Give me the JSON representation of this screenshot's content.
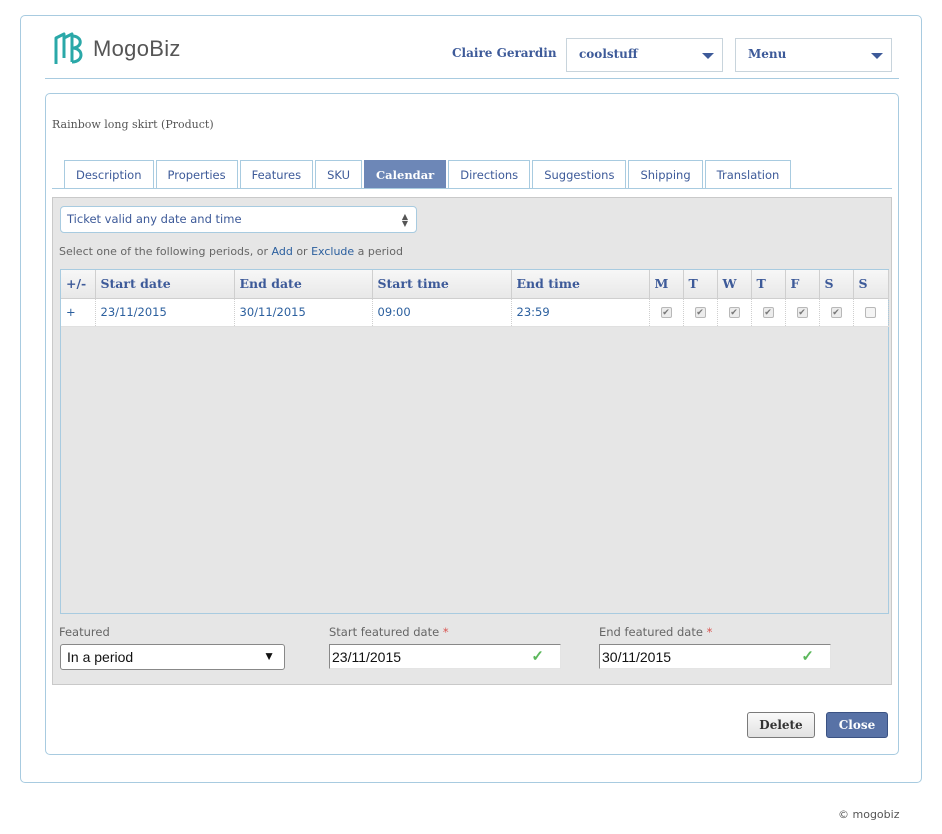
{
  "brand": {
    "name": "MogoBiz",
    "accent": "#2aa8a8"
  },
  "header": {
    "user_name": "Claire Gerardin",
    "store_select": "coolstuff",
    "menu_select": "Menu"
  },
  "product_title": "Rainbow long skirt (Product)",
  "tabs": [
    {
      "label": "Description"
    },
    {
      "label": "Properties"
    },
    {
      "label": "Features"
    },
    {
      "label": "SKU"
    },
    {
      "label": "Calendar",
      "active": true
    },
    {
      "label": "Directions"
    },
    {
      "label": "Suggestions"
    },
    {
      "label": "Shipping"
    },
    {
      "label": "Translation"
    }
  ],
  "calendar": {
    "validity_select": "Ticket valid any date and time",
    "hint_prefix": "Select one of the following periods, or",
    "hint_add": "Add",
    "hint_or": "or",
    "hint_exclude": "Exclude",
    "hint_suffix": "a period",
    "columns": {
      "toggle": "+/-",
      "start_date": "Start date",
      "end_date": "End date",
      "start_time": "Start time",
      "end_time": "End time",
      "days": [
        "M",
        "T",
        "W",
        "T",
        "F",
        "S",
        "S"
      ]
    },
    "periods": [
      {
        "toggle": "+",
        "start_date": "23/11/2015",
        "end_date": "30/11/2015",
        "start_time": "09:00",
        "end_time": "23:59",
        "days_checked": [
          true,
          true,
          true,
          true,
          true,
          true,
          false
        ]
      }
    ]
  },
  "featured": {
    "label": "Featured",
    "value": "In a period",
    "start_label": "Start featured date",
    "start_value": "23/11/2015",
    "end_label": "End featured date",
    "end_value": "30/11/2015",
    "required_mark": "*"
  },
  "buttons": {
    "delete": "Delete",
    "close": "Close"
  },
  "footer": {
    "copyright": "© mogobiz"
  }
}
